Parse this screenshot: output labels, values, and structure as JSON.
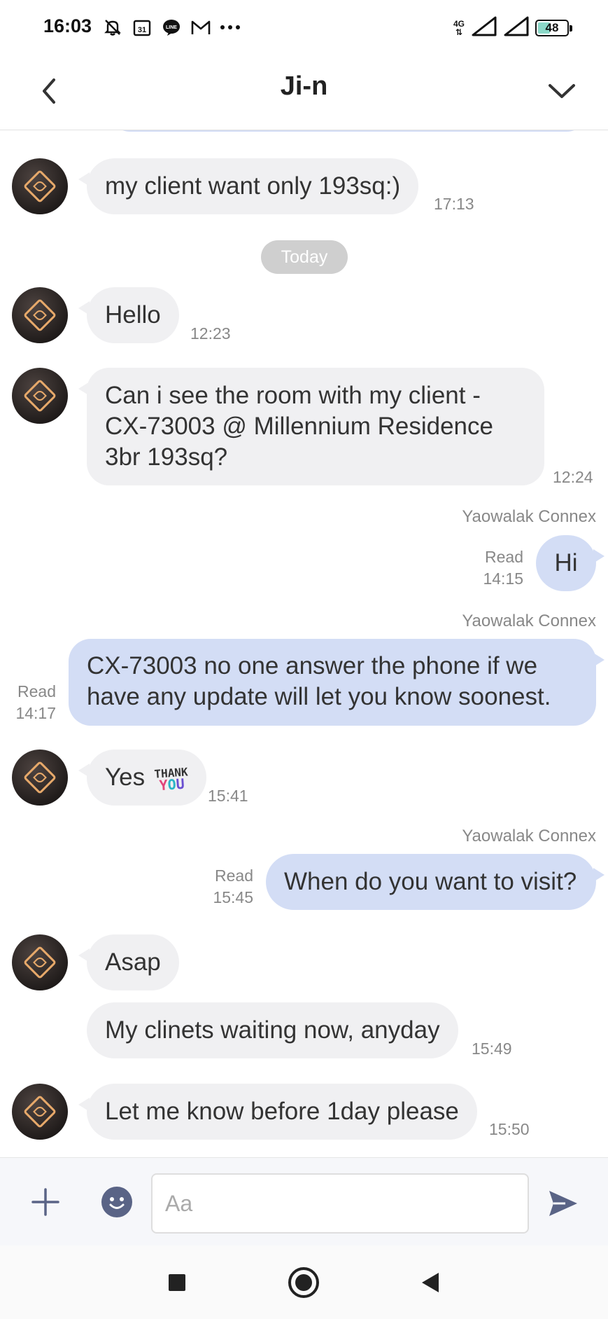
{
  "status_bar": {
    "time": "16:03",
    "network": "4G",
    "battery": "48",
    "battery_percent": 48,
    "icons": [
      "notifications-off-icon",
      "calendar-31-icon",
      "line-app-icon",
      "gmail-icon",
      "more-dots-icon",
      "signal-icon",
      "signal-icon",
      "battery-icon"
    ]
  },
  "header": {
    "title": "Ji-n",
    "back_icon": "chevron-left-icon",
    "menu_icon": "chevron-down-icon"
  },
  "chat": {
    "date_separator": "Today",
    "messages": [
      {
        "direction": "in",
        "text": "my client want only 193sq:)",
        "time": "17:13"
      },
      {
        "direction": "in",
        "text": "Hello",
        "time": "12:23"
      },
      {
        "direction": "in",
        "lines": [
          "Can i see the room with my client -",
          "CX-73003 @ Millennium Residence",
          "3br 193sq?"
        ],
        "time": "12:24"
      },
      {
        "direction": "out",
        "sender": "Yaowalak Connex",
        "text": "Hi",
        "status": "Read",
        "time": "14:15"
      },
      {
        "direction": "out",
        "sender": "Yaowalak Connex",
        "lines": [
          "CX-73003 no one answer the phone if we",
          "have any update will let you know soonest."
        ],
        "status": "Read",
        "time": "14:17"
      },
      {
        "direction": "in",
        "text": "Yes",
        "sticker": {
          "line1": "THANK",
          "y": "Y",
          "o": "O",
          "u": "U"
        },
        "time": "15:41"
      },
      {
        "direction": "out",
        "sender": "Yaowalak Connex",
        "text": "When do you want to visit?",
        "status": "Read",
        "time": "15:45"
      },
      {
        "direction": "in",
        "text": "Asap"
      },
      {
        "direction": "in",
        "text": "My clinets waiting now, anyday",
        "time": "15:49"
      },
      {
        "direction": "in",
        "text": "Let me know before 1day please",
        "time": "15:50"
      }
    ]
  },
  "input": {
    "placeholder": "Aa",
    "value": ""
  },
  "colors": {
    "incoming_bubble": "#f0f0f2",
    "outgoing_bubble": "#d3ddf5",
    "date_chip": "#cfcfcf",
    "icon_accent": "#5a6486"
  }
}
